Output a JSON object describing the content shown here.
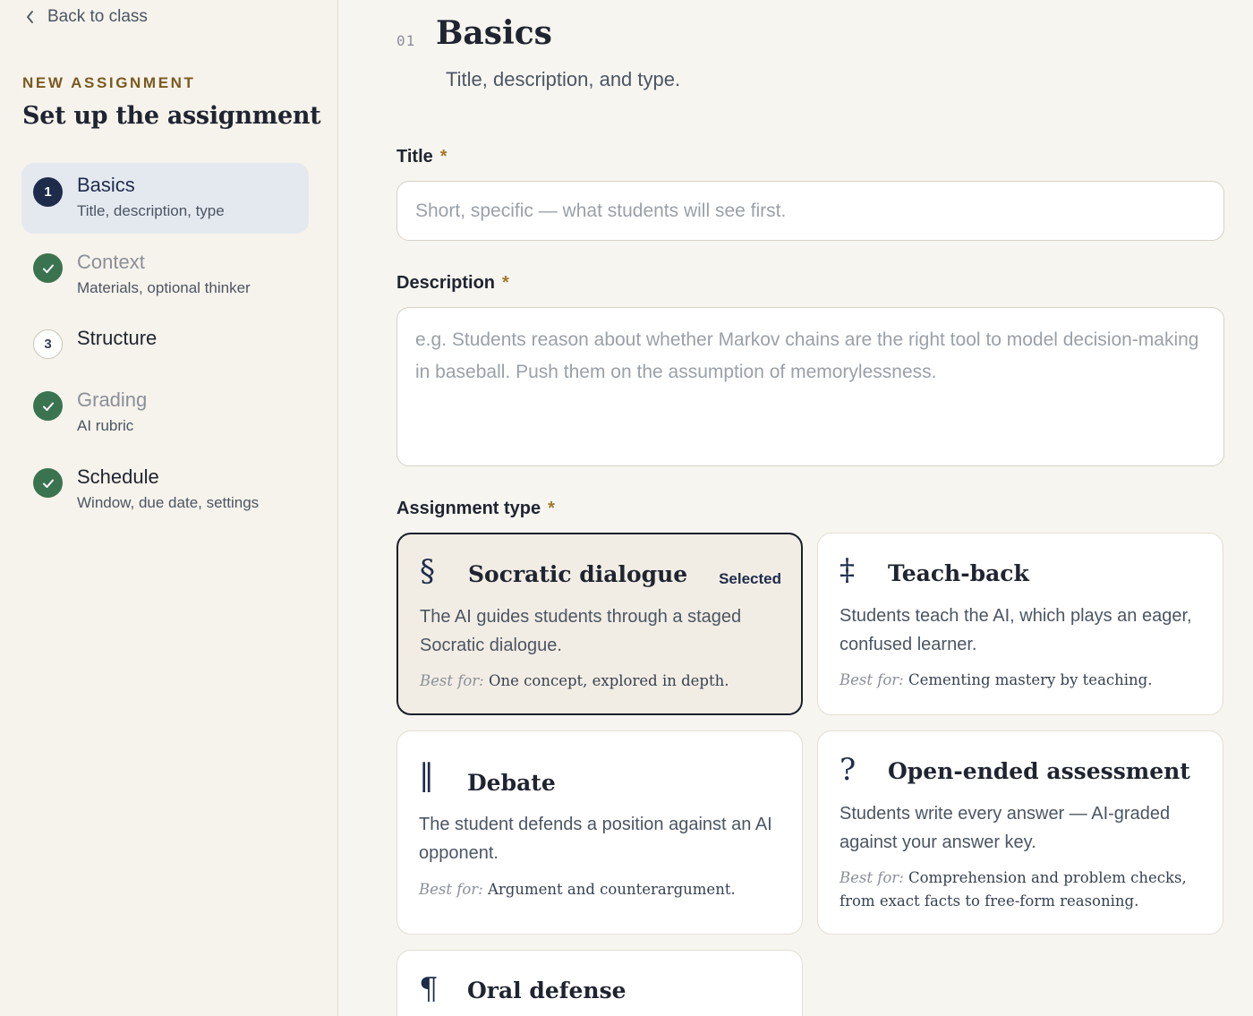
{
  "sidebar": {
    "back_label": "Back to class",
    "eyebrow": "NEW ASSIGNMENT",
    "title": "Set up the assignment",
    "steps": [
      {
        "number": "1",
        "label": "Basics",
        "sub": "Title, description, type",
        "state": "active"
      },
      {
        "number": "✓",
        "label": "Context",
        "sub": "Materials, optional thinker",
        "state": "done"
      },
      {
        "number": "3",
        "label": "Structure",
        "sub": "",
        "state": "pending"
      },
      {
        "number": "✓",
        "label": "Grading",
        "sub": "AI rubric",
        "state": "done"
      },
      {
        "number": "✓",
        "label": "Schedule",
        "sub": "Window, due date, settings",
        "state": "done"
      }
    ]
  },
  "section": {
    "number": "01",
    "title": "Basics",
    "subtitle": "Title, description, and type."
  },
  "fields": {
    "title_label": "Title",
    "title_placeholder": "Short, specific — what students will see first.",
    "title_value": "",
    "description_label": "Description",
    "description_placeholder": "e.g. Students reason about whether Markov chains are the right tool to model decision-making in baseball. Push them on the assumption of memorylessness.",
    "description_value": "",
    "type_label": "Assignment type",
    "required_mark": "*"
  },
  "types": [
    {
      "icon": "§",
      "title": "Socratic dialogue",
      "badge": "Selected",
      "desc": "The AI guides students through a staged Socratic dialogue.",
      "best_key": "Best for:",
      "best_value": "One concept, explored in depth.",
      "selected": true
    },
    {
      "icon": "‡",
      "title": "Teach-back",
      "badge": "",
      "desc": "Students teach the AI, which plays an eager, confused learner.",
      "best_key": "Best for:",
      "best_value": "Cementing mastery by teaching.",
      "selected": false
    },
    {
      "icon": "‖",
      "title": "Debate",
      "badge": "",
      "desc": "The student defends a position against an AI opponent.",
      "best_key": "Best for:",
      "best_value": "Argument and counterargument.",
      "selected": false
    },
    {
      "icon": "?",
      "title": "Open-ended assessment",
      "badge": "",
      "desc": "Students write every answer — AI-graded against your answer key.",
      "best_key": "Best for:",
      "best_value": "Comprehension and problem checks, from exact facts to free-form reasoning.",
      "selected": false
    },
    {
      "icon": "¶",
      "title": "Oral defense",
      "badge": "",
      "desc": "",
      "best_key": "",
      "best_value": "",
      "selected": false
    }
  ],
  "colors": {
    "accent_navy": "#1e2c4c",
    "done_green": "#3a7350",
    "eyebrow_gold": "#7a5a1f",
    "page_bg": "#f7f5f0"
  }
}
